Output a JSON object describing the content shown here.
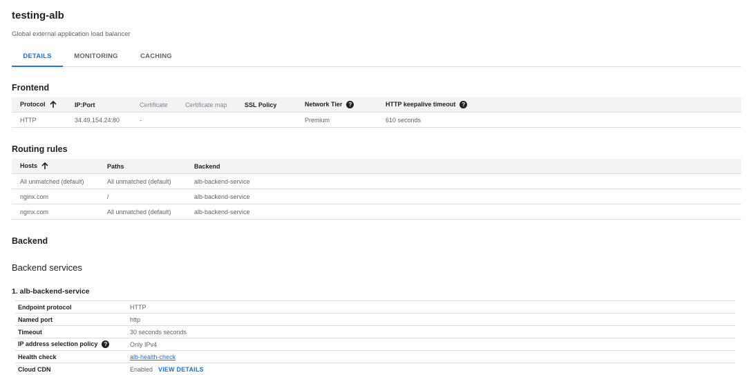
{
  "header": {
    "title": "testing-alb",
    "subtitle": "Global external application load balancer"
  },
  "tabs": [
    {
      "label": "DETAILS",
      "active": true
    },
    {
      "label": "MONITORING",
      "active": false
    },
    {
      "label": "CACHING",
      "active": false
    }
  ],
  "frontend": {
    "heading": "Frontend",
    "columns": [
      "Protocol",
      "IP:Port",
      "Certificate",
      "Certificate map",
      "SSL Policy",
      "Network Tier",
      "HTTP keepalive timeout"
    ],
    "rows": [
      [
        "HTTP",
        "34.49.154.24:80",
        "-",
        "",
        "",
        "Premium",
        "610 seconds"
      ]
    ]
  },
  "routing": {
    "heading": "Routing rules",
    "columns": [
      "Hosts",
      "Paths",
      "Backend"
    ],
    "rows": [
      [
        "All unmatched (default)",
        "All unmatched (default)",
        "alb-backend-service"
      ],
      [
        "nginx.com",
        "/",
        "alb-backend-service"
      ],
      [
        "nginx.com",
        "All unmatched (default)",
        "alb-backend-service"
      ]
    ]
  },
  "backend": {
    "heading": "Backend",
    "services_heading": "Backend services",
    "service_title": "1. alb-backend-service",
    "details": [
      {
        "key": "Endpoint protocol",
        "value": "HTTP"
      },
      {
        "key": "Named port",
        "value": "http"
      },
      {
        "key": "Timeout",
        "value": "30 seconds seconds"
      },
      {
        "key": "IP address selection policy",
        "value": "Only IPv4"
      },
      {
        "key": "Health check",
        "value": "alb-health-check"
      },
      {
        "key": "Cloud CDN",
        "value": "Enabled",
        "action": "VIEW DETAILS"
      }
    ]
  },
  "icons": {
    "sort": "arrow-up-icon",
    "help": "help-circle-icon"
  },
  "colors": {
    "accent": "#1a73e8",
    "header_bg": "#f1f3f4",
    "border": "#dadce0"
  }
}
